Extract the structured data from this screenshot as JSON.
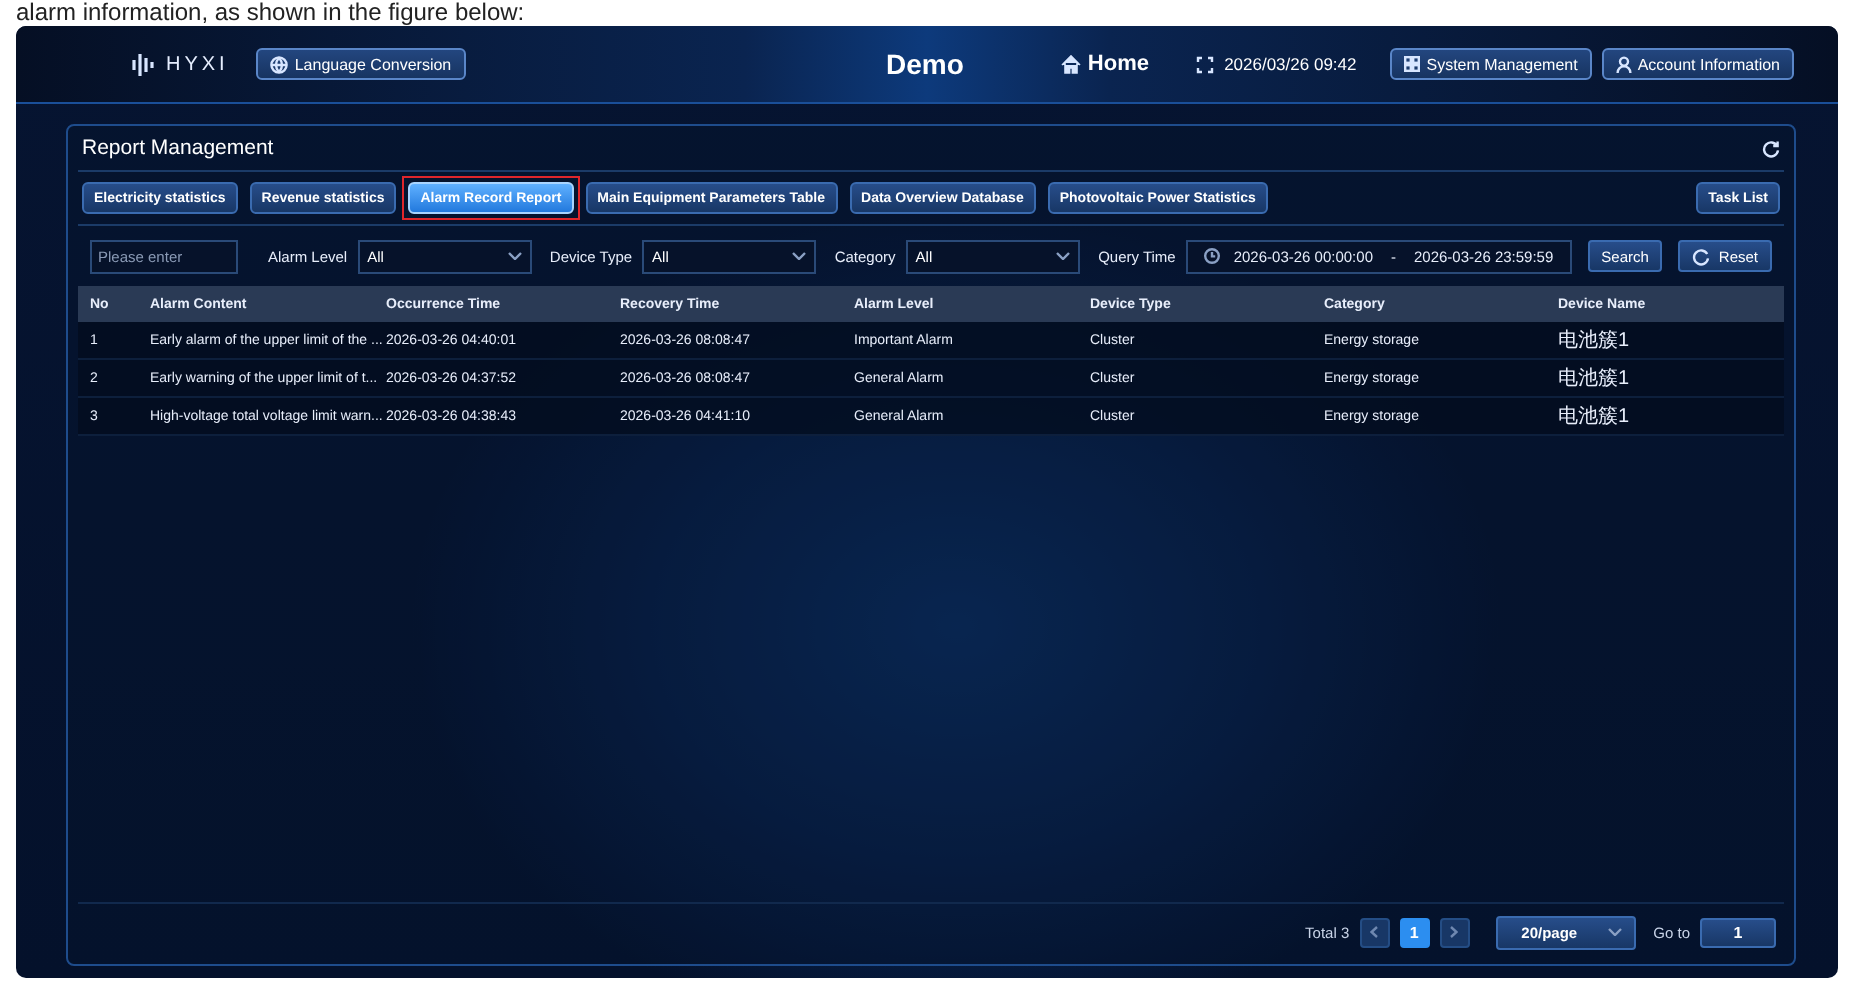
{
  "caption": "alarm information, as shown in the figure below:",
  "header": {
    "logo_text": "HYXI",
    "language_button": "Language Conversion",
    "title": "Demo",
    "home": "Home",
    "datetime": "2026/03/26 09:42",
    "buttons": [
      {
        "label": "System Management",
        "kind": "grid"
      },
      {
        "label": "Account Information",
        "kind": "person"
      }
    ]
  },
  "panel": {
    "title": "Report Management",
    "tabs": [
      {
        "label": "Electricity statistics",
        "selected": false,
        "marked": false
      },
      {
        "label": "Revenue statistics",
        "selected": false,
        "marked": false
      },
      {
        "label": "Alarm Record Report",
        "selected": true,
        "marked": true
      },
      {
        "label": "Main Equipment Parameters Table",
        "selected": false,
        "marked": false
      },
      {
        "label": "Data Overview Database",
        "selected": false,
        "marked": false
      },
      {
        "label": "Photovoltaic Power Statistics",
        "selected": false,
        "marked": false
      }
    ],
    "task_list": "Task List",
    "filters": {
      "keyword": {
        "placeholder": "Please enter"
      },
      "selects": [
        {
          "label": "Alarm Level",
          "value": "All"
        },
        {
          "label": "Device Type",
          "value": "All"
        },
        {
          "label": "Category",
          "value": "All"
        }
      ],
      "query_time": {
        "label": "Query Time",
        "start": "2026-03-26 00:00:00",
        "separator": "-",
        "end": "2026-03-26 23:59:59"
      },
      "search": "Search",
      "reset": "Reset"
    },
    "table": {
      "columns": [
        "No",
        "Alarm Content",
        "Occurrence Time",
        "Recovery Time",
        "Alarm Level",
        "Device Type",
        "Category",
        "Device Name"
      ],
      "rows": [
        [
          "1",
          "Early alarm of the upper limit of the ...",
          "2026-03-26 04:40:01",
          "2026-03-26 08:08:47",
          "Important Alarm",
          "Cluster",
          "Energy storage",
          "电池簇1"
        ],
        [
          "2",
          "Early warning of the upper limit of t...",
          "2026-03-26 04:37:52",
          "2026-03-26 08:08:47",
          "General Alarm",
          "Cluster",
          "Energy storage",
          "电池簇1"
        ],
        [
          "3",
          "High-voltage total voltage limit warn...",
          "2026-03-26 04:38:43",
          "2026-03-26 04:41:10",
          "General Alarm",
          "Cluster",
          "Energy storage",
          "电池簇1"
        ]
      ]
    },
    "pagination": {
      "total": "Total 3",
      "pages": [
        {
          "label": "1",
          "selected": true
        }
      ],
      "page_size": "20/page",
      "goto_label": "Go to",
      "goto_value": "1"
    }
  }
}
